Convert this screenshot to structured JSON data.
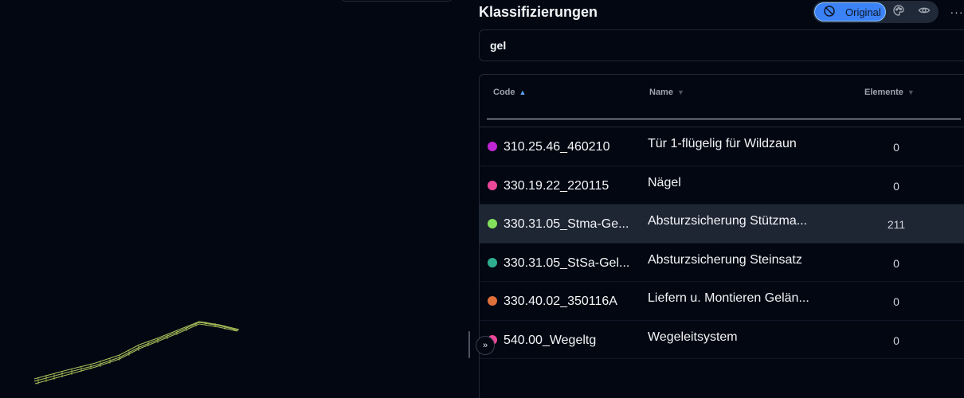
{
  "panel": {
    "title": "Klassifizierungen",
    "modes": {
      "original_label": "Original"
    },
    "search": {
      "value": "gel",
      "placeholder": ""
    }
  },
  "table": {
    "columns": {
      "code": "Code",
      "name": "Name",
      "count": "Elemente"
    },
    "rows": [
      {
        "code": "310.25.46_460210",
        "name": "Tür 1-flügelig für Wildzaun",
        "count": "0",
        "color": "#c026d3"
      },
      {
        "code": "330.19.22_220115",
        "name": "Nägel",
        "count": "0",
        "color": "#ec4899"
      },
      {
        "code": "330.31.05_Stma-Ge...",
        "name": "Absturzsicherung Stützma...",
        "count": "211",
        "color": "#84e05c"
      },
      {
        "code": "330.31.05_StSa-Gel...",
        "name": "Absturzsicherung Steinsatz",
        "count": "0",
        "color": "#2fae8f"
      },
      {
        "code": "330.40.02_350116A",
        "name": "Liefern u. Montieren Gelän...",
        "count": "0",
        "color": "#e0703a"
      },
      {
        "code": "540.00_Wegeltg",
        "name": "Wegeleitsystem",
        "count": "0",
        "color": "#ec4899"
      }
    ]
  },
  "icons": {
    "mode_original": "eye-off-icon",
    "mode_color": "palette-icon",
    "mode_visibility": "eye-icon",
    "more": "more-horizontal-icon",
    "expand": "chevrons-right-icon"
  }
}
